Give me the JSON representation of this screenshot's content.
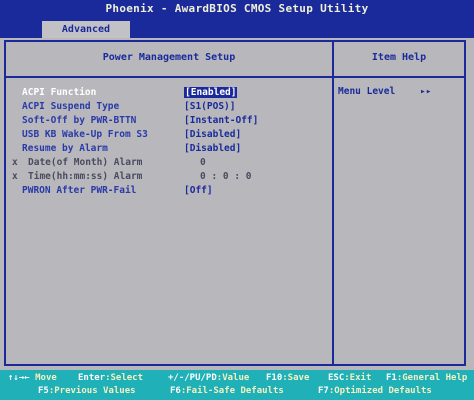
{
  "app": {
    "title": "Phoenix - AwardBIOS CMOS Setup Utility"
  },
  "menu": {
    "active_tab": "Advanced"
  },
  "section": {
    "title": "Power Management Setup",
    "help_title": "Item Help"
  },
  "settings": [
    {
      "label": "ACPI Function",
      "value": "[Enabled]"
    },
    {
      "label": "ACPI Suspend Type",
      "value": "[S1(POS)]"
    },
    {
      "label": "Soft-Off by PWR-BTTN",
      "value": "[Instant-Off]"
    },
    {
      "label": "USB KB Wake-Up From S3",
      "value": "[Disabled]"
    },
    {
      "label": "Resume by Alarm",
      "value": "[Disabled]"
    },
    {
      "prefix": "x",
      "label": "Date(of Month) Alarm",
      "value": "0"
    },
    {
      "prefix": "x",
      "label": "Time(hh:mm:ss) Alarm",
      "value": "0 : 0 : 0"
    },
    {
      "label": "PWRON After PWR-Fail",
      "value": "[Off]"
    }
  ],
  "help": {
    "text": "Menu Level",
    "arrows": "▸▸"
  },
  "hotkeys": {
    "row1": [
      {
        "key": "↑↓→←",
        "desc": "Move"
      },
      {
        "key": "Enter",
        "desc": ":Select"
      },
      {
        "key": "+/-/PU/PD",
        "desc": ":Value"
      },
      {
        "key": "F10",
        "desc": ":Save"
      },
      {
        "key": "ESC",
        "desc": ":Exit"
      },
      {
        "key": "F1",
        "desc": ":General Help"
      }
    ],
    "row2": [
      {
        "key": "F5",
        "desc": ":Previous Values"
      },
      {
        "key": "F6",
        "desc": ":Fail-Safe Defaults"
      },
      {
        "key": "F7",
        "desc": ":Optimized Defaults"
      }
    ]
  },
  "colors": {
    "screen_bg": "#b8b8bc",
    "bios_blue": "#1a2a9a",
    "hotkey_bar": "#1fb0b8"
  }
}
